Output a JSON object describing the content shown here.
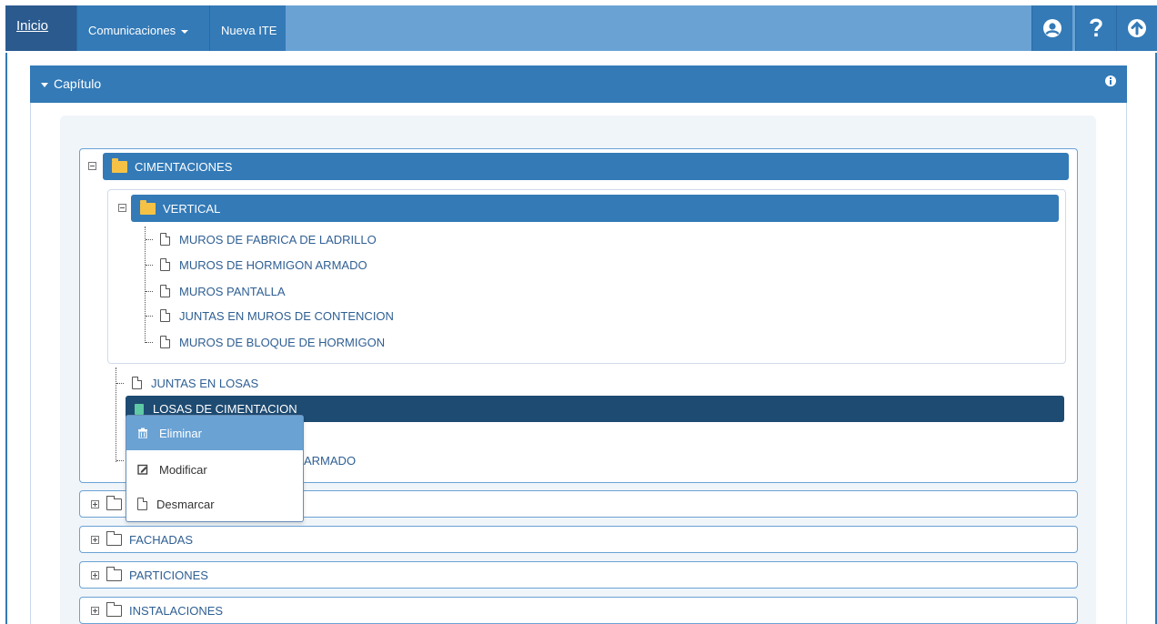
{
  "navbar": {
    "home": "Inicio",
    "comms": "Comunicaciones",
    "new_ite": "Nueva ITE",
    "icons": [
      "user-circle-icon",
      "help-icon",
      "upload-icon"
    ]
  },
  "panel": {
    "title": "Capítulo"
  },
  "tree": {
    "root": "CIMENTACIONES",
    "sub_folder": "VERTICAL",
    "sub_items": [
      "MUROS DE FABRICA DE LADRILLO",
      "MUROS DE HORMIGON ARMADO",
      "MUROS PANTALLA",
      "JUNTAS EN MUROS DE CONTENCION",
      "MUROS DE BLOQUE DE HORMIGON"
    ],
    "items": [
      "JUNTAS EN LOSAS",
      "LOSAS DE CIMENTACION",
      "ARMADO"
    ],
    "collapsed": [
      "FACHADAS",
      "PARTICIONES",
      "INSTALACIONES"
    ]
  },
  "context_menu": {
    "items": [
      "Eliminar",
      "Modificar",
      "Desmarcar"
    ]
  }
}
